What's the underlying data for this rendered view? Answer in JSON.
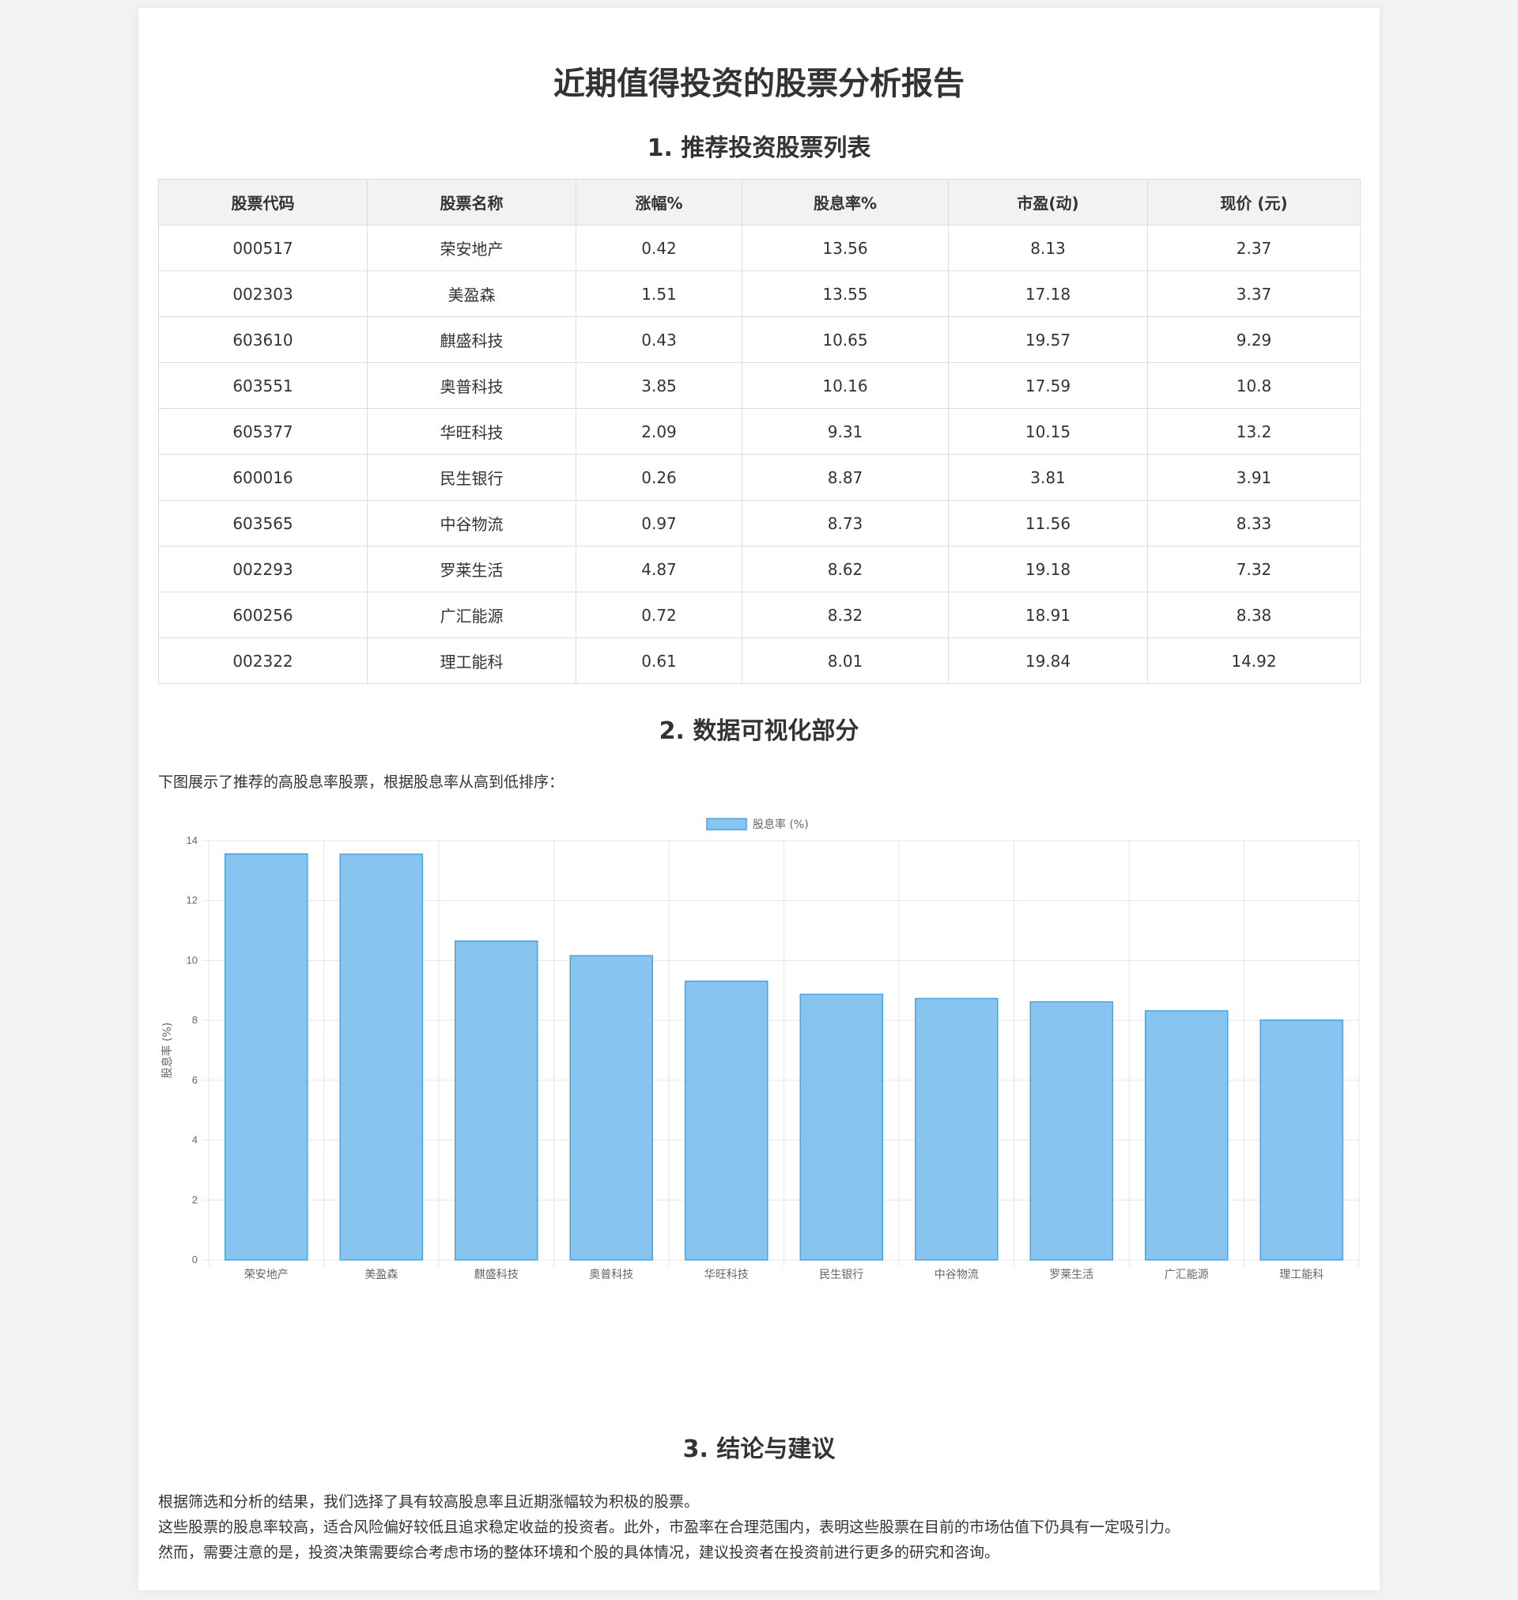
{
  "title": "近期值得投资的股票分析报告",
  "section1": {
    "heading": "1. 推荐投资股票列表",
    "columns": [
      "股票代码",
      "股票名称",
      "涨幅%",
      "股息率%",
      "市盈(动)",
      "现价 (元)"
    ],
    "rows": [
      [
        "000517",
        "荣安地产",
        "0.42",
        "13.56",
        "8.13",
        "2.37"
      ],
      [
        "002303",
        "美盈森",
        "1.51",
        "13.55",
        "17.18",
        "3.37"
      ],
      [
        "603610",
        "麒盛科技",
        "0.43",
        "10.65",
        "19.57",
        "9.29"
      ],
      [
        "603551",
        "奥普科技",
        "3.85",
        "10.16",
        "17.59",
        "10.8"
      ],
      [
        "605377",
        "华旺科技",
        "2.09",
        "9.31",
        "10.15",
        "13.2"
      ],
      [
        "600016",
        "民生银行",
        "0.26",
        "8.87",
        "3.81",
        "3.91"
      ],
      [
        "603565",
        "中谷物流",
        "0.97",
        "8.73",
        "11.56",
        "8.33"
      ],
      [
        "002293",
        "罗莱生活",
        "4.87",
        "8.62",
        "19.18",
        "7.32"
      ],
      [
        "600256",
        "广汇能源",
        "0.72",
        "8.32",
        "18.91",
        "8.38"
      ],
      [
        "002322",
        "理工能科",
        "0.61",
        "8.01",
        "19.84",
        "14.92"
      ]
    ]
  },
  "section2": {
    "heading": "2. 数据可视化部分",
    "intro": "下图展示了推荐的高股息率股票，根据股息率从高到低排序："
  },
  "chart_data": {
    "type": "bar",
    "categories": [
      "荣安地产",
      "美盈森",
      "麒盛科技",
      "奥普科技",
      "华旺科技",
      "民生银行",
      "中谷物流",
      "罗莱生活",
      "广汇能源",
      "理工能科"
    ],
    "series": [
      {
        "name": "股息率 (%)",
        "values": [
          13.56,
          13.55,
          10.65,
          10.16,
          9.31,
          8.87,
          8.73,
          8.62,
          8.32,
          8.01
        ]
      }
    ],
    "ylabel": "股息率 (%)",
    "xlabel": "",
    "ylim": [
      0,
      14
    ],
    "yticks": [
      "0",
      "2",
      "4",
      "6",
      "8",
      "10",
      "12",
      "14"
    ],
    "grid": true,
    "legend": "top-center",
    "bar_fill": "#87c4f0",
    "bar_stroke": "#4aa3e0",
    "grid_color": "#e5e5e5",
    "text_color": "#666666"
  },
  "section3": {
    "heading": "3. 结论与建议",
    "lines": [
      "根据筛选和分析的结果，我们选择了具有较高股息率且近期涨幅较为积极的股票。",
      "这些股票的股息率较高，适合风险偏好较低且追求稳定收益的投资者。此外，市盈率在合理范围内，表明这些股票在目前的市场估值下仍具有一定吸引力。",
      "然而，需要注意的是，投资决策需要综合考虑市场的整体环境和个股的具体情况，建议投资者在投资前进行更多的研究和咨询。"
    ]
  }
}
